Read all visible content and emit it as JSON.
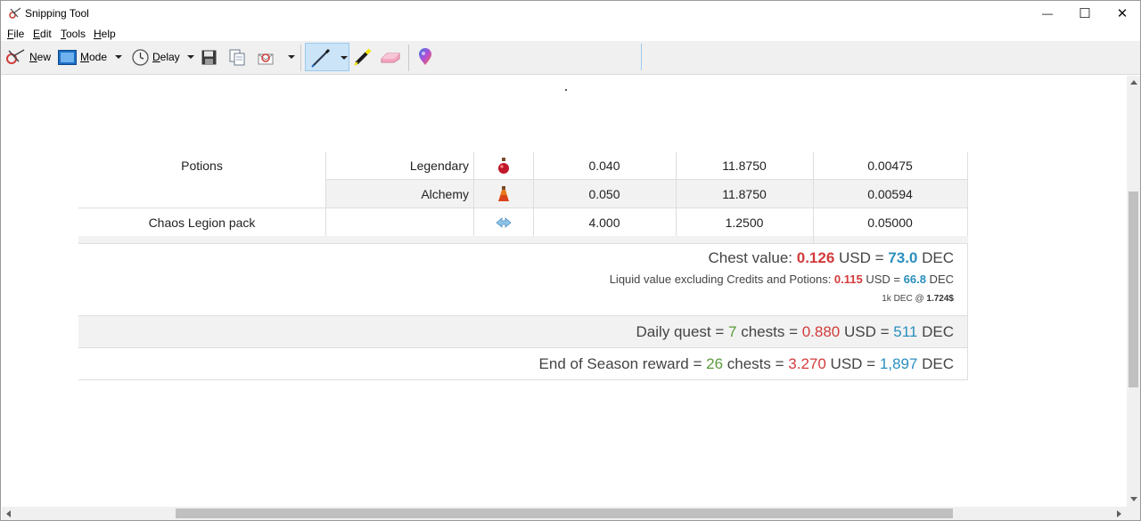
{
  "window": {
    "title": "Snipping Tool",
    "minimize_glyph": "—",
    "maximize_glyph": "☐",
    "close_glyph": "✕"
  },
  "menu": {
    "file": {
      "acc": "F",
      "rest": "ile"
    },
    "edit": {
      "acc": "E",
      "rest": "dit"
    },
    "tools": {
      "acc": "T",
      "rest": "ools"
    },
    "help": {
      "acc": "H",
      "rest": "elp"
    }
  },
  "toolbar": {
    "new": {
      "acc": "N",
      "rest": "ew",
      "icon": "new-snip-icon"
    },
    "mode": {
      "acc": "M",
      "rest": "ode",
      "icon": "mode-icon"
    },
    "delay": {
      "acc": "D",
      "rest": "elay",
      "icon": "clock-icon"
    },
    "save_icon": "save-icon",
    "copy_icon": "copy-icon",
    "send_icon": "send-snip-icon",
    "pen_icon": "pen-icon",
    "highlighter_icon": "highlighter-icon",
    "eraser_icon": "eraser-icon",
    "paint3d_icon": "paint3d-icon"
  },
  "table": {
    "rows": [
      {
        "name": "Potions",
        "sub": "Legendary",
        "icon": "legendary-potion-icon",
        "c1": "0.040",
        "c2": "11.8750",
        "c3": "0.00475"
      },
      {
        "name": "",
        "sub": "Alchemy",
        "icon": "alchemy-potion-icon",
        "c1": "0.050",
        "c2": "11.8750",
        "c3": "0.00594"
      },
      {
        "name": "Chaos Legion pack",
        "sub": "",
        "icon": "chaos-legion-pack-icon",
        "c1": "4.000",
        "c2": "1.2500",
        "c3": "0.05000"
      }
    ]
  },
  "summary": {
    "chest": {
      "label": "Chest value: ",
      "usd": "0.126",
      "usd_unit": " USD = ",
      "dec": "73.0",
      "dec_unit": " DEC"
    },
    "liquid": {
      "label": "Liquid value excluding Credits and Potions: ",
      "usd": "0.115",
      "usd_unit": " USD = ",
      "dec": "66.8",
      "dec_unit": " DEC"
    },
    "rate": {
      "label": "1k DEC @ ",
      "value": "1.724$"
    },
    "daily": {
      "label": "Daily quest = ",
      "chests": "7",
      "chests_unit": " chests = ",
      "usd": "0.880",
      "usd_unit": " USD = ",
      "dec": "511",
      "dec_unit": " DEC"
    },
    "season": {
      "label": "End of Season reward = ",
      "chests": "26",
      "chests_unit": " chests = ",
      "usd": "3.270",
      "usd_unit": " USD = ",
      "dec": "1,897",
      "dec_unit": " DEC"
    }
  },
  "colors": {
    "red": "#d23b3b",
    "blue": "#2a8fbd",
    "green": "#5b9b3a",
    "row_alt": "#f2f2f2",
    "toolbar_bg": "#f0f0f0",
    "pen_selected": "#cce4f7"
  }
}
